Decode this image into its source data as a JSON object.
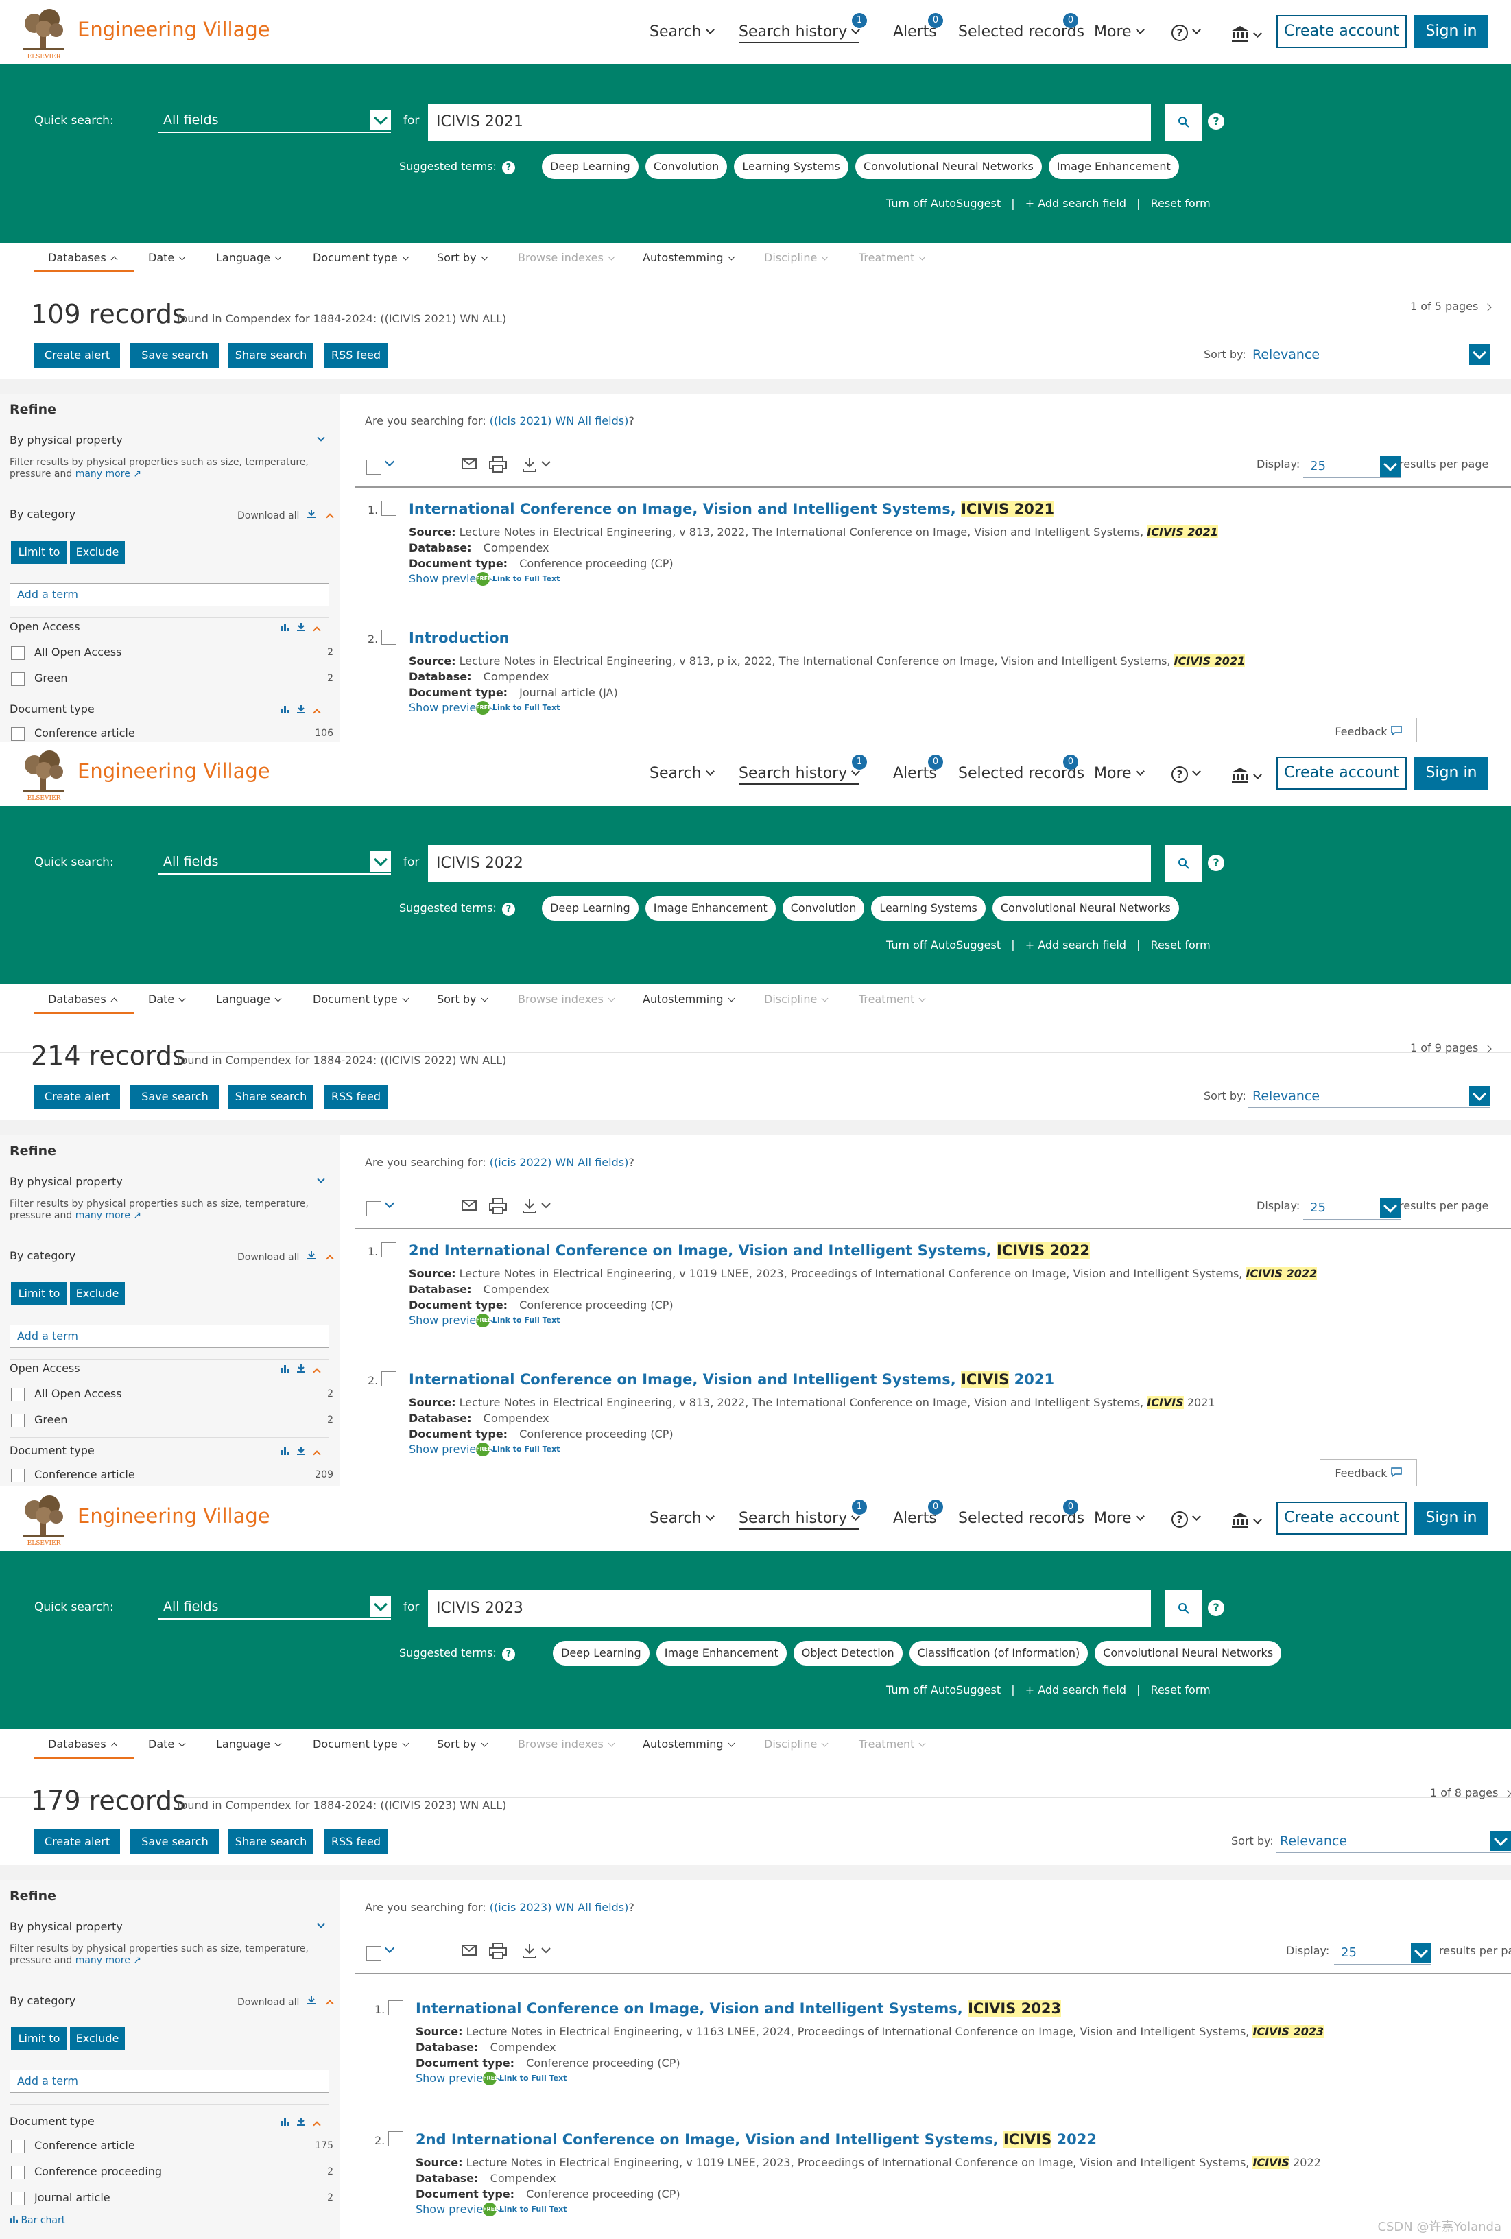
{
  "app": {
    "brand": "Engineering Village",
    "logo_text": "ELSEVIER",
    "nav": {
      "search": "Search",
      "search_history": "Search history",
      "search_history_badge": "1",
      "alerts": "Alerts",
      "alerts_badge": "0",
      "selected_records": "Selected records",
      "selected_badge": "0",
      "more": "More",
      "help": "?"
    },
    "create_account": "Create account",
    "sign_in": "Sign in"
  },
  "common": {
    "quick_search_label": "Quick search:",
    "field": "All fields",
    "for": "for",
    "help": "?",
    "suggested_label": "Suggested terms:",
    "turn_off": "Turn off AutoSuggest",
    "pipe": "|",
    "add_field": "+ Add search field",
    "reset": "Reset form",
    "tabs": [
      "Databases",
      "Date",
      "Language",
      "Document type",
      "Sort by",
      "Browse indexes",
      "Autostemming",
      "Discipline",
      "Treatment"
    ],
    "create_alert": "Create alert",
    "save_search": "Save search",
    "share_search": "Share search",
    "rss_feed": "RSS feed",
    "sort_by": "Sort by:",
    "sort_value": "Relevance",
    "refine": "Refine",
    "by_physical": "By physical property",
    "physical_help": "Filter results by physical properties such as size, temperature, pressure and",
    "many_more": "many more",
    "by_category": "By category",
    "download_all": "Download all",
    "limit_to": "Limit to",
    "exclude": "Exclude",
    "add_term": "Add a term",
    "open_access": "Open Access",
    "all_open_access": "All Open Access",
    "green": "Green",
    "document_type": "Document type",
    "conference_article": "Conference article",
    "conference_proceeding": "Conference proceeding",
    "journal_article": "Journal article",
    "bar_chart": "Bar chart",
    "searching_for": "Are you searching for:",
    "display": "Display:",
    "display_value": "25",
    "rpp": "results per page",
    "show_preview": "Show preview",
    "full_text": "Link to Full Text",
    "full_text_badge": "FREE",
    "source": "Source:",
    "database": "Database:",
    "doctype": "Document type:",
    "compendex": "Compendex",
    "feedback": "Feedback"
  },
  "panels": [
    {
      "query": "ICIVIS 2021",
      "chips": [
        "Deep Learning",
        "Convolution",
        "Learning Systems",
        "Convolutional Neural Networks",
        "Image Enhancement"
      ],
      "count": "109 records",
      "found": "found in Compendex for 1884-2024: ((ICIVIS 2021) WN ALL)",
      "pages": "1 of 5 pages",
      "suggestion_link": "((icis 2021) WN All fields)",
      "oa_all_count": "2",
      "oa_green_count": "2",
      "conf_article_count": "106",
      "results": [
        {
          "num": "1.",
          "title": "International Conference on Image, Vision and Intelligent Systems,",
          "title_hl": "ICIVIS 2021",
          "source": "Lecture Notes in Electrical Engineering, v 813, 2022, The International Conference on Image, Vision and Intelligent Systems,",
          "source_hl": "ICIVIS 2021",
          "source_tail": "",
          "doctype": "Conference proceeding (CP)"
        },
        {
          "num": "2.",
          "title": "Introduction",
          "title_hl": "",
          "source": "Lecture Notes in Electrical Engineering, v 813, p ix, 2022, The International Conference on Image, Vision and Intelligent Systems,",
          "source_hl": "ICIVIS 2021",
          "source_tail": "",
          "doctype": "Journal article (JA)"
        }
      ]
    },
    {
      "query": "ICIVIS 2022",
      "chips": [
        "Deep Learning",
        "Image Enhancement",
        "Convolution",
        "Learning Systems",
        "Convolutional Neural Networks"
      ],
      "count": "214 records",
      "found": "found in Compendex for 1884-2024: ((ICIVIS 2022) WN ALL)",
      "pages": "1 of 9 pages",
      "suggestion_link": "((icis 2022) WN All fields)",
      "oa_all_count": "2",
      "oa_green_count": "2",
      "conf_article_count": "209",
      "results": [
        {
          "num": "1.",
          "title": "2nd International Conference on Image, Vision and Intelligent Systems,",
          "title_hl": "ICIVIS 2022",
          "source": "Lecture Notes in Electrical Engineering, v 1019 LNEE, 2023, Proceedings of International Conference on Image, Vision and Intelligent Systems,",
          "source_hl": "ICIVIS 2022",
          "source_tail": "",
          "doctype": "Conference proceeding (CP)"
        },
        {
          "num": "2.",
          "title": "International Conference on Image, Vision and Intelligent Systems,",
          "title_hl": "ICIVIS",
          "title_tail": "2021",
          "source": "Lecture Notes in Electrical Engineering, v 813, 2022, The International Conference on Image, Vision and Intelligent Systems,",
          "source_hl": "ICIVIS",
          "source_tail": "2021",
          "doctype": "Conference proceeding (CP)"
        }
      ]
    },
    {
      "query": "ICIVIS 2023",
      "chips": [
        "Deep Learning",
        "Image Enhancement",
        "Object Detection",
        "Classification (of Information)",
        "Convolutional Neural Networks"
      ],
      "count": "179 records",
      "found": "found in Compendex for 1884-2024: ((ICIVIS 2023) WN ALL)",
      "pages": "1 of 8 pages",
      "suggestion_link": "((icis 2023) WN All fields)",
      "conf_article_count": "175",
      "conf_proceeding_count": "2",
      "journal_article_count": "2",
      "results": [
        {
          "num": "1.",
          "title": "International Conference on Image, Vision and Intelligent Systems,",
          "title_hl": "ICIVIS 2023",
          "source": "Lecture Notes in Electrical Engineering, v 1163 LNEE, 2024, Proceedings of International Conference on Image, Vision and Intelligent Systems,",
          "source_hl": "ICIVIS 2023",
          "source_tail": "",
          "doctype": "Conference proceeding (CP)"
        },
        {
          "num": "2.",
          "title": "2nd International Conference on Image, Vision and Intelligent Systems,",
          "title_hl": "ICIVIS",
          "title_tail": "2022",
          "source": "Lecture Notes in Electrical Engineering, v 1019 LNEE, 2023, Proceedings of International Conference on Image, Vision and Intelligent Systems,",
          "source_hl": "ICIVIS",
          "source_tail": "2022",
          "doctype": "Conference proceeding (CP)"
        }
      ]
    }
  ],
  "watermark": "CSDN @许嘉Yolanda",
  "colors": {
    "green": "#00816a",
    "blue": "#00729e",
    "orange": "#e9711c",
    "link": "#1a6fa8",
    "highlight": "#fff59d"
  }
}
